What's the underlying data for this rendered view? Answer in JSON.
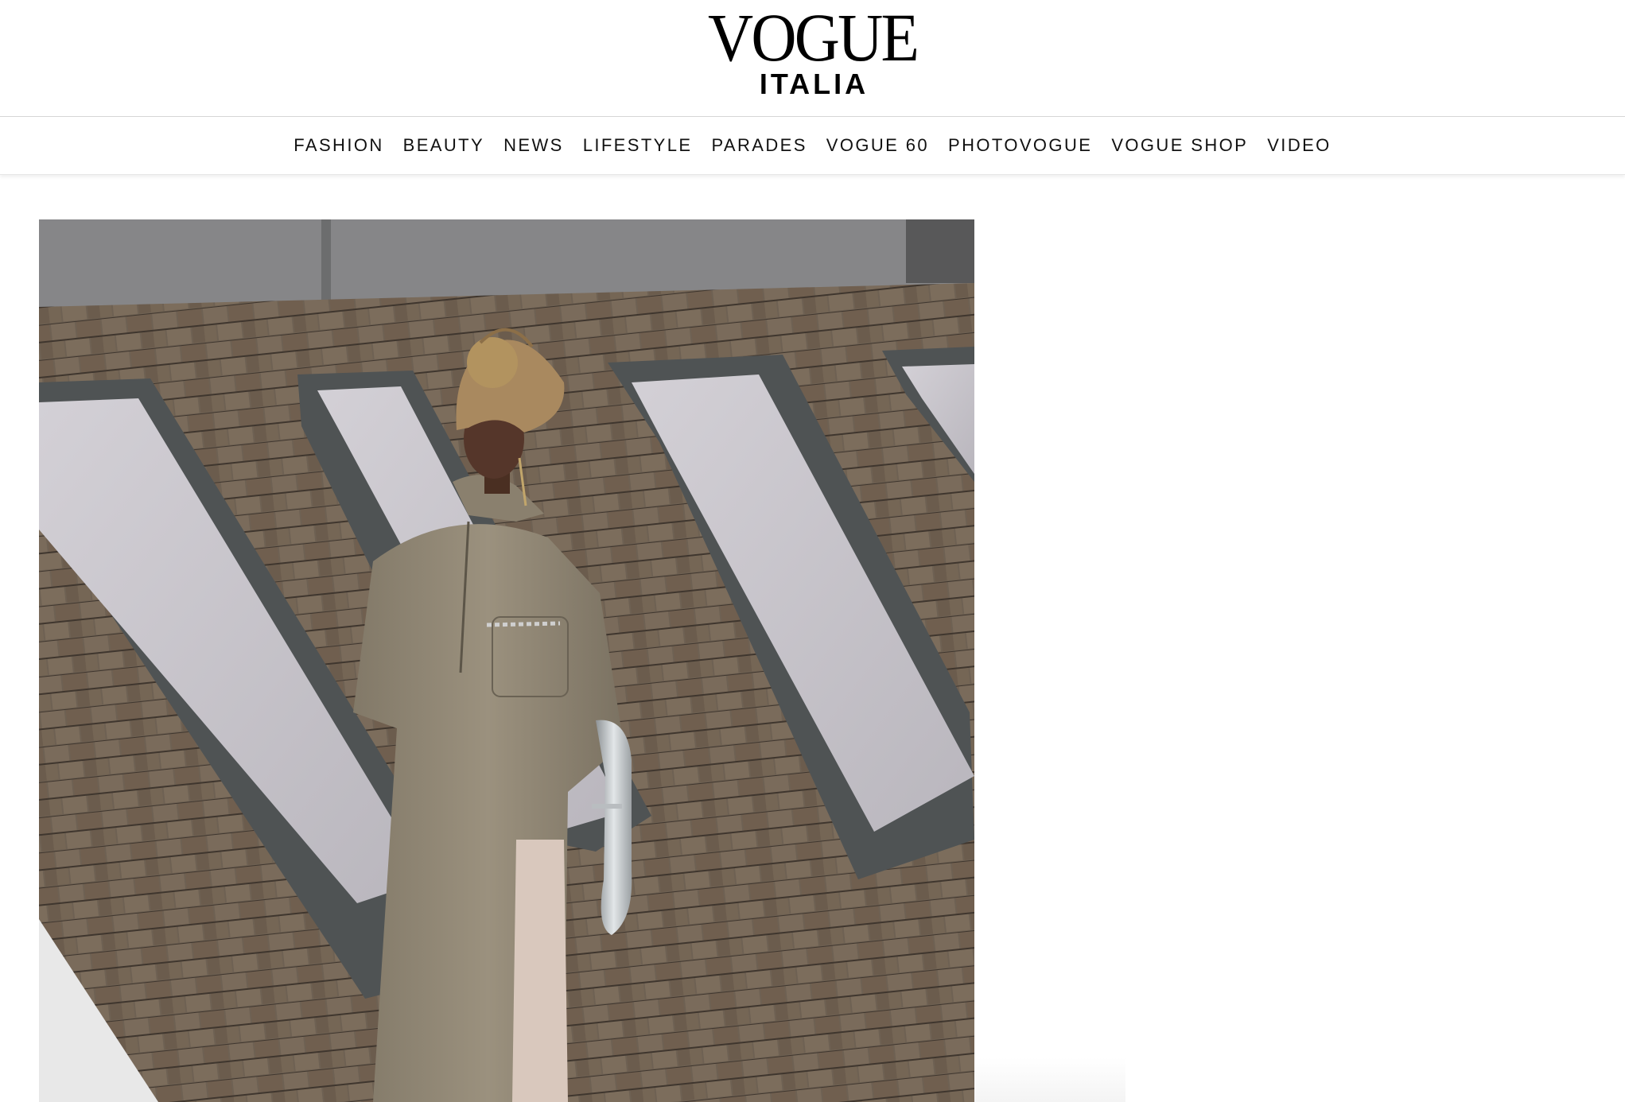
{
  "header": {
    "logo_title": "VOGUE",
    "logo_subtitle": "ITALIA"
  },
  "nav": {
    "items": [
      {
        "label": "FASHION"
      },
      {
        "label": "BEAUTY"
      },
      {
        "label": "NEWS"
      },
      {
        "label": "LIFESTYLE"
      },
      {
        "label": "PARADES"
      },
      {
        "label": "VOGUE 60"
      },
      {
        "label": "PHOTOVOGUE"
      },
      {
        "label": "VOGUE SHOP"
      },
      {
        "label": "VIDEO"
      }
    ]
  },
  "colors": {
    "background": "#ffffff",
    "text": "#111111",
    "divider": "#d6d6d6"
  }
}
